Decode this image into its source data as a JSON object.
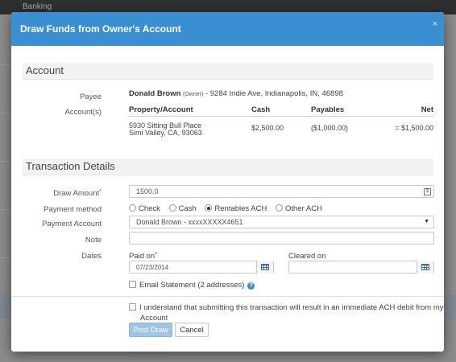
{
  "background": {
    "nav_text": "Banking"
  },
  "modal": {
    "title": "Draw Funds from Owner's Account",
    "close": "×"
  },
  "account": {
    "heading": "Account",
    "payee_label": "Payee",
    "payee_name": "Donald Brown",
    "payee_role": "(Owner)",
    "payee_address": "- 9284 Indie Ave, Indianapolis, IN, 46898",
    "accounts_label": "Account(s)",
    "table": {
      "headers": [
        "Property/Account",
        "Cash",
        "Payables",
        "Net"
      ],
      "row": {
        "property_line1": "5930 Sitting Bull Place",
        "property_line2": "Simi Valley, CA, 93063",
        "cash": "$2,500.00",
        "payables": "($1,000.00)",
        "net": "= $1,500.00"
      }
    }
  },
  "transaction": {
    "heading": "Transaction Details",
    "draw_amount_label": "Draw Amount",
    "draw_amount_value": "1500.0",
    "draw_amount_icon": "$",
    "payment_method_label": "Payment method",
    "payment_methods": [
      "Check",
      "Cash",
      "Rentables ACH",
      "Other ACH"
    ],
    "payment_method_selected": "Rentables ACH",
    "payment_account_label": "Payment Account",
    "payment_account_value": "Donald Brown - xxxxXXXXX4651",
    "note_label": "Note",
    "note_value": "",
    "dates_label": "Dates",
    "paid_on_label": "Paid on",
    "paid_on_value": "07/23/2014",
    "cleared_on_label": "Cleared on",
    "cleared_on_value": "",
    "email_label": "Email Statement (2 addresses)",
    "help_icon": "?"
  },
  "footer": {
    "acknowledge_line1": "I understand that submitting this transaction will result in an immediate ACH debit from my Trust",
    "acknowledge_line2": "Account",
    "post_label": "Post Draw",
    "cancel_label": "Cancel"
  },
  "colors": {
    "header": "#3a8fd3",
    "primary_disabled": "#9ec5e6"
  }
}
